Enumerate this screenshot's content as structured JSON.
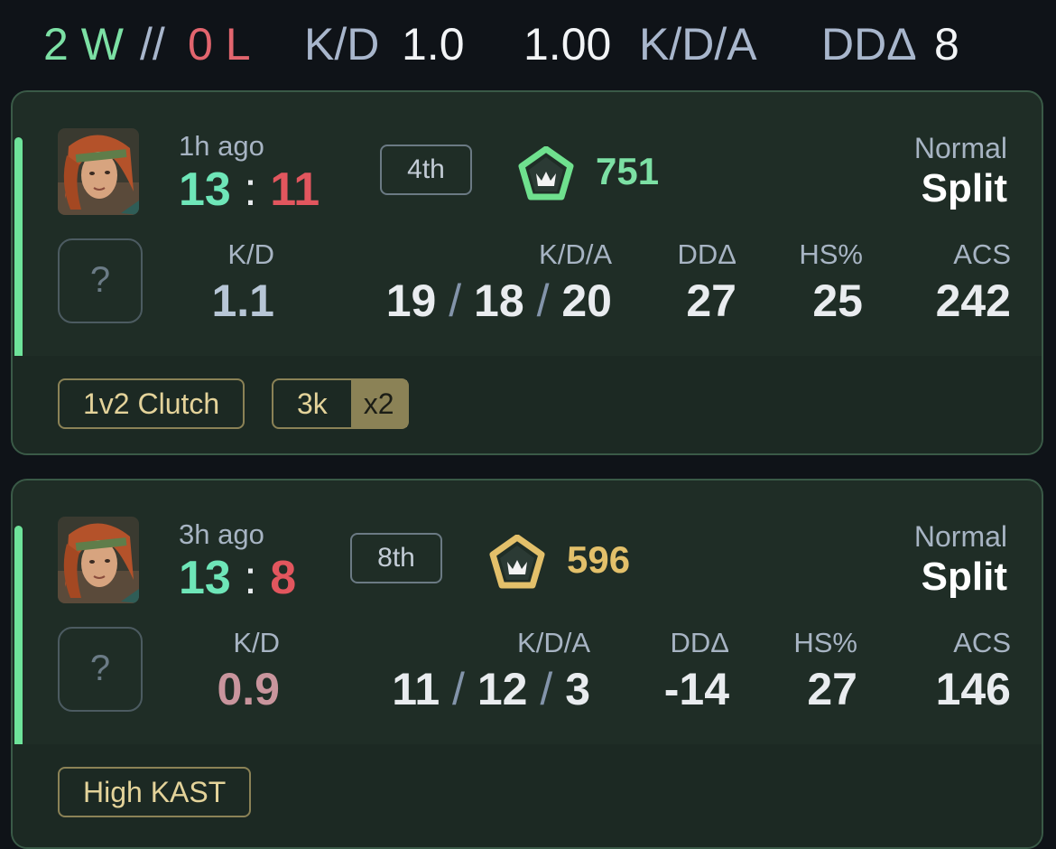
{
  "summary": {
    "wins": "2 W",
    "sep": "//",
    "losses": "0 L",
    "kd_label": "K/D",
    "kd_value": "1.0",
    "kda_value": "1.00",
    "kda_label": "K/D/A",
    "dda_label": "DDΔ",
    "dda_value": "8"
  },
  "colors": {
    "win": "#7ce0a4",
    "loss": "#e2656e",
    "accent_bar": "#6ee39a",
    "rank_green": "#6fe08e",
    "rank_gold": "#e3c06a",
    "tag_gold": "#8b8256"
  },
  "matches": [
    {
      "ago": "1h ago",
      "score_team": "13",
      "score_sep": ":",
      "score_enemy": "11",
      "placement": "4th",
      "rank_icon": "rank-emblem-green-icon",
      "rr": "751",
      "rr_color": "#7ce0a4",
      "mode": "Normal",
      "map": "Split",
      "avatar_icon": "agent-avatar-icon",
      "unknown_icon": "?",
      "labels": {
        "kd": "K/D",
        "kda": "K/D/A",
        "dda": "DDΔ",
        "hs": "HS%",
        "acs": "ACS"
      },
      "kd": "1.1",
      "kills": "19",
      "deaths": "18",
      "assists": "20",
      "slash": "/",
      "dda": "27",
      "hs": "25",
      "acs": "242",
      "tags": [
        {
          "label": "1v2 Clutch"
        },
        {
          "label": "3k",
          "mult": "x2"
        }
      ]
    },
    {
      "ago": "3h ago",
      "score_team": "13",
      "score_sep": ":",
      "score_enemy": "8",
      "placement": "8th",
      "rank_icon": "rank-emblem-gold-icon",
      "rr": "596",
      "rr_color": "#e3c06a",
      "mode": "Normal",
      "map": "Split",
      "avatar_icon": "agent-avatar-icon",
      "unknown_icon": "?",
      "labels": {
        "kd": "K/D",
        "kda": "K/D/A",
        "dda": "DDΔ",
        "hs": "HS%",
        "acs": "ACS"
      },
      "kd": "0.9",
      "kills": "11",
      "deaths": "12",
      "assists": "3",
      "slash": "/",
      "dda": "-14",
      "hs": "27",
      "acs": "146",
      "tags": [
        {
          "label": "High KAST"
        }
      ]
    }
  ]
}
